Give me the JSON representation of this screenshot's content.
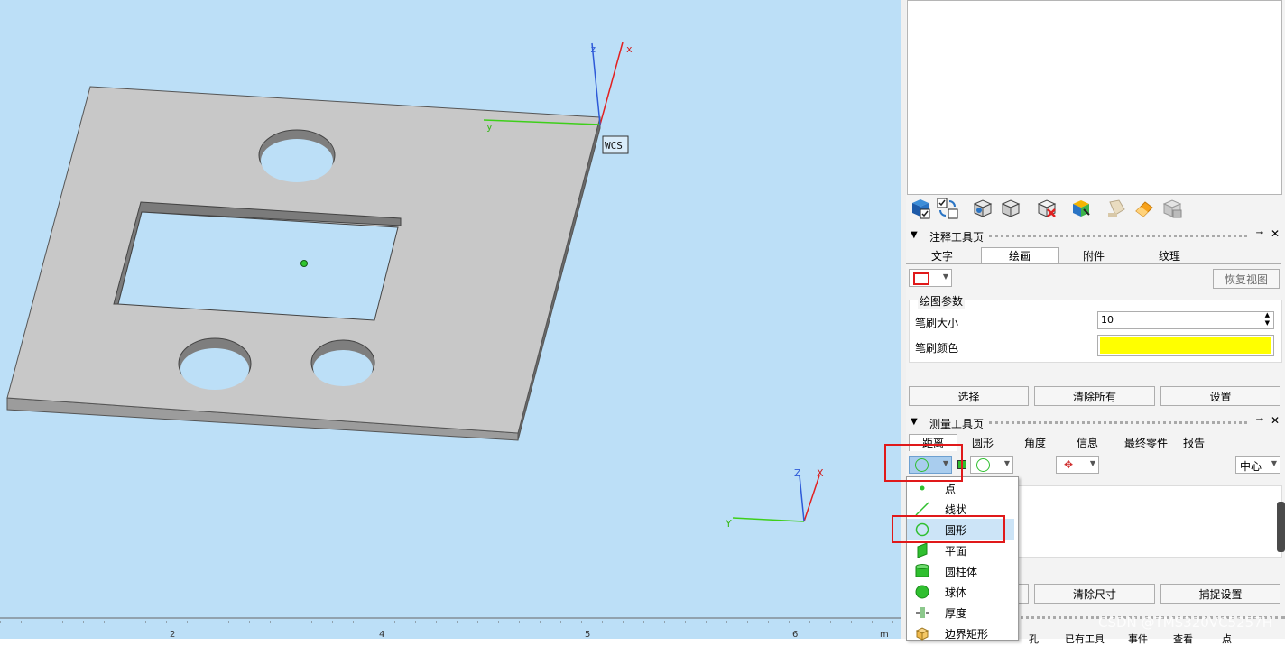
{
  "viewport": {
    "bg": "#bcdff7",
    "wcs_label": "WCS",
    "axis_main": {
      "x": "x",
      "y": "y",
      "z": "z"
    },
    "axis_corner": {
      "x": "X",
      "y": "Y",
      "z": "Z"
    },
    "ruler": {
      "ticks": [
        "2",
        "4",
        "5",
        "6",
        "m"
      ]
    }
  },
  "toolbar_icons": [
    "cube-checked-icon",
    "checkbox-swap-icon",
    "cube-view-icon",
    "cube-view-icon-2",
    "cube-delete-icon",
    "cube-color-icon",
    "paint-bucket-icon",
    "eraser-icon",
    "cube-gray-icon"
  ],
  "annotation_panel": {
    "title": "注释工具页",
    "tabs": [
      "文字",
      "绘画",
      "附件",
      "纹理"
    ],
    "active_tab": "绘画",
    "restore_view": "恢复视图",
    "group_title": "绘图参数",
    "brush_size_label": "笔刷大小",
    "brush_size_value": "10",
    "brush_color_label": "笔刷颜色",
    "brush_color": "#ffff00",
    "buttons": [
      "选择",
      "清除所有",
      "设置"
    ]
  },
  "measure_panel": {
    "title": "测量工具页",
    "tabs": [
      "距离",
      "圆形",
      "角度",
      "信息",
      "最终零件",
      "报告"
    ],
    "active_tab": "距离",
    "center_select": "中心",
    "buttons": [
      "清除尺寸",
      "捕捉设置"
    ]
  },
  "dropdown_menu": {
    "items": [
      {
        "label": "点",
        "icon": "dot-icon"
      },
      {
        "label": "线状",
        "icon": "line-icon"
      },
      {
        "label": "圆形",
        "icon": "circle-icon"
      },
      {
        "label": "平面",
        "icon": "plane-icon"
      },
      {
        "label": "圆柱体",
        "icon": "cylinder-icon"
      },
      {
        "label": "球体",
        "icon": "sphere-icon"
      },
      {
        "label": "厚度",
        "icon": "thickness-icon"
      },
      {
        "label": "边界矩形",
        "icon": "bounding-box-icon"
      }
    ],
    "selected": "圆形"
  },
  "bottom_partial_tabs": [
    "孔",
    "已有工具",
    "事件",
    "查看",
    "点"
  ],
  "watermark": "CSDN @TMS320VC5257H"
}
